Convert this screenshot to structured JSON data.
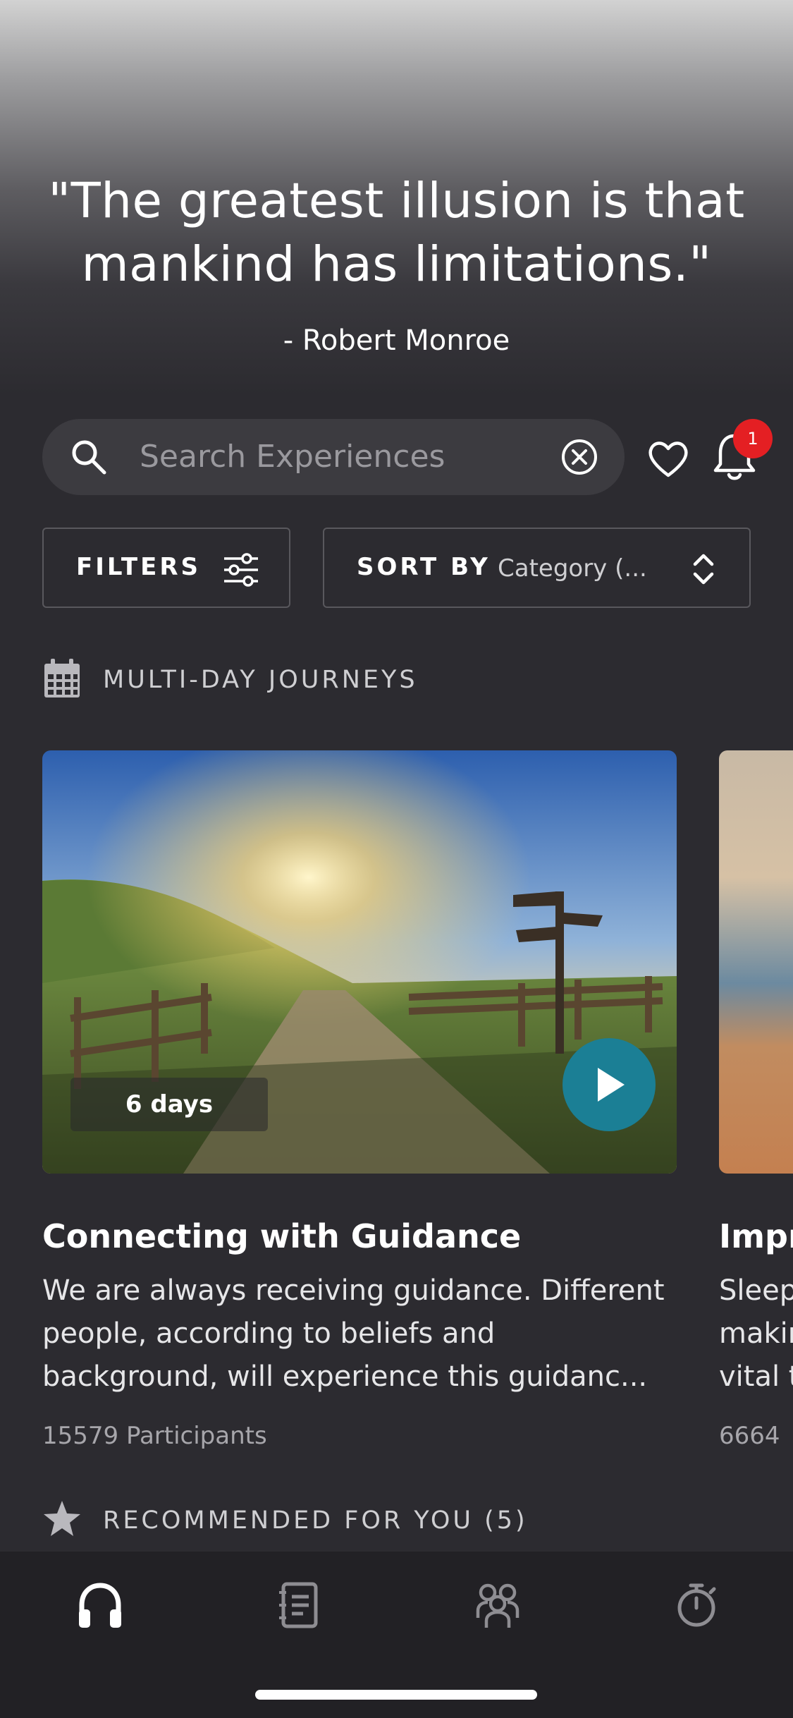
{
  "quote": {
    "text": "\"The greatest illusion is that mankind has limitations.\"",
    "author": "- Robert Monroe"
  },
  "search": {
    "placeholder": "Search Experiences"
  },
  "notifications": {
    "badge_count": "1"
  },
  "filters": {
    "label": "FILTERS"
  },
  "sort": {
    "label": "SORT BY",
    "value": "Category (..."
  },
  "sections": [
    {
      "title": "MULTI-DAY JOURNEYS",
      "icon": "calendar-icon"
    },
    {
      "title": "RECOMMENDED FOR YOU (5)",
      "icon": "star-icon"
    }
  ],
  "journeys": [
    {
      "duration": "6 days",
      "title": "Connecting with Guidance",
      "description": "We are always receiving guidance. Different people, according to beliefs and background, will experience this guidanc...",
      "participants": "15579 Participants"
    },
    {
      "title": "Impr",
      "description_lines": [
        "Sleep",
        "makir",
        "vital t"
      ],
      "participants": "6664"
    }
  ],
  "tabbar": {
    "tabs": [
      {
        "icon": "headphones-icon",
        "active": true
      },
      {
        "icon": "journal-icon",
        "active": false
      },
      {
        "icon": "community-icon",
        "active": false
      },
      {
        "icon": "timer-icon",
        "active": false
      }
    ],
    "active_color": "#ffffff",
    "inactive_color": "#8e8d92"
  },
  "colors": {
    "background": "#2c2b30",
    "accent": "#1b7f95",
    "badge": "#e41f23"
  }
}
